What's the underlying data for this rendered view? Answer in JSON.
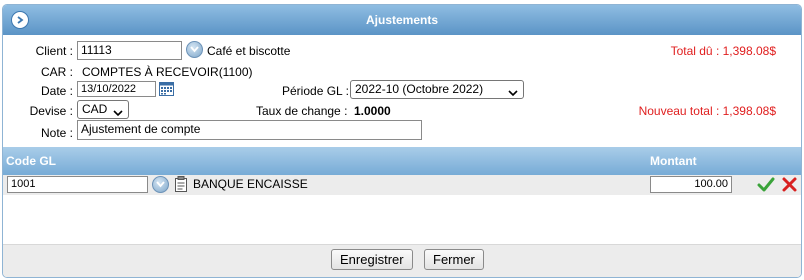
{
  "window": {
    "title": "Ajustements"
  },
  "form": {
    "client_label": "Client :",
    "client_value": "11113",
    "client_name": "Café et biscotte",
    "car_label": "CAR :",
    "car_value": "COMPTES À RECEVOIR(1100)",
    "date_label": "Date :",
    "date_value": "13/10/2022",
    "periode_label": "Période GL :",
    "periode_value": "2022-10 (Octobre 2022)",
    "devise_label": "Devise :",
    "devise_value": "CAD",
    "taux_label": "Taux de change :",
    "taux_value": "1.0000",
    "note_label": "Note :",
    "note_value": "Ajustement de compte",
    "total_du": "Total dû :  1,398.08$",
    "nouveau_total": "Nouveau total :  1,398.08$"
  },
  "grid": {
    "columns": {
      "code_gl": "Code GL",
      "montant": "Montant"
    },
    "rows": [
      {
        "code": "1001",
        "description": "BANQUE ENCAISSE",
        "montant": "100.00"
      }
    ]
  },
  "buttons": {
    "save": "Enregistrer",
    "close": "Fermer"
  },
  "colors": {
    "title_bar": "#5b94c6",
    "total_text": "#e01e1e",
    "confirm": "#3aa33a",
    "delete": "#d82020"
  }
}
